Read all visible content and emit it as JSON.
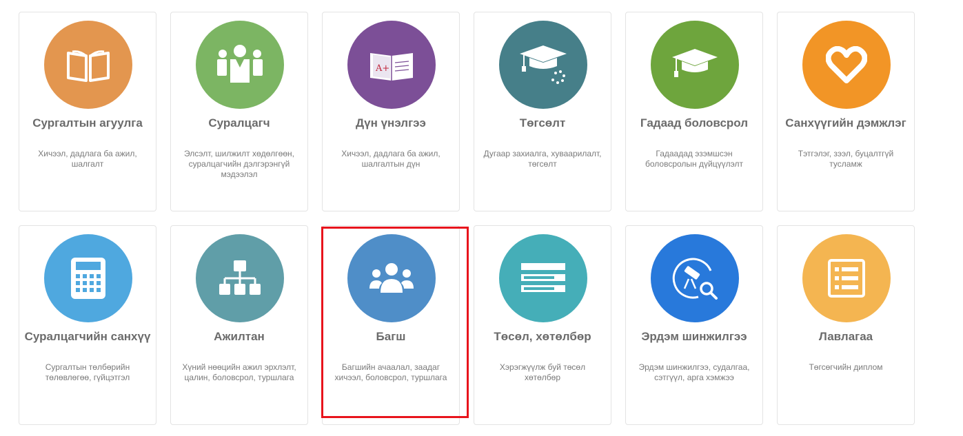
{
  "cards": [
    {
      "title": "Сургалтын агуулга",
      "desc": "Хичээл, дадлага ба ажил, шалгалт",
      "icon": "open-book-icon",
      "color": "#e3964f"
    },
    {
      "title": "Суралцагч",
      "desc": "Элсэлт, шилжилт хөдөлгөөн, суралцагчийн дэлгэрэнгүй мэдээлэл",
      "icon": "students-icon",
      "color": "#7cb563"
    },
    {
      "title": "Дүн үнэлгээ",
      "desc": "Хичээл, дадлага ба ажил, шалгалтын дүн",
      "icon": "graded-book-icon",
      "color": "#7c4f97"
    },
    {
      "title": "Төгсөлт",
      "desc": "Дугаар захиалга, хуваарилалт, төгсөлт",
      "icon": "graduation-cap-icon",
      "color": "#467f89"
    },
    {
      "title": "Гадаад боловсрол",
      "desc": "Гадаадад эзэмшсэн боловсролын дүйцүүлэлт",
      "icon": "graduation-cap-icon",
      "color": "#6ea53d"
    },
    {
      "title": "Санхүүгийн дэмжлэг",
      "desc": "Тэтгэлэг, зээл, буцалтгүй тусламж",
      "icon": "heart-icon",
      "color": "#f29526"
    },
    {
      "title": "Суралцагчийн санхүү",
      "desc": "Сургалтын төлбөрийн төлөвлөгөө, гүйцэтгэл",
      "icon": "calculator-icon",
      "color": "#4fa8df"
    },
    {
      "title": "Ажилтан",
      "desc": "Хүний нөөцийн ажил эрхлэлт, цалин, боловсрол, туршлага",
      "icon": "org-chart-icon",
      "color": "#609ea8"
    },
    {
      "title": "Багш",
      "desc": "Багшийн ачаалал, заадаг хичээл, боловсрол, туршлага",
      "icon": "teachers-group-icon",
      "color": "#4f8ec8"
    },
    {
      "title": "Төсөл, хөтөлбөр",
      "desc": "Хэрэгжүүлж буй төсөл хөтөлбөр",
      "icon": "list-bars-icon",
      "color": "#45aeb8"
    },
    {
      "title": "Эрдэм шинжилгээ",
      "desc": "Эрдэм шинжилгээ, судалгаа, сэтгүүл, арга хэмжээ",
      "icon": "telescope-search-icon",
      "color": "#2879db"
    },
    {
      "title": "Лавлагаа",
      "desc": "Төгсөгчийн диплом",
      "icon": "document-list-icon",
      "color": "#f4b551"
    }
  ],
  "highlighted_card": "Багш"
}
